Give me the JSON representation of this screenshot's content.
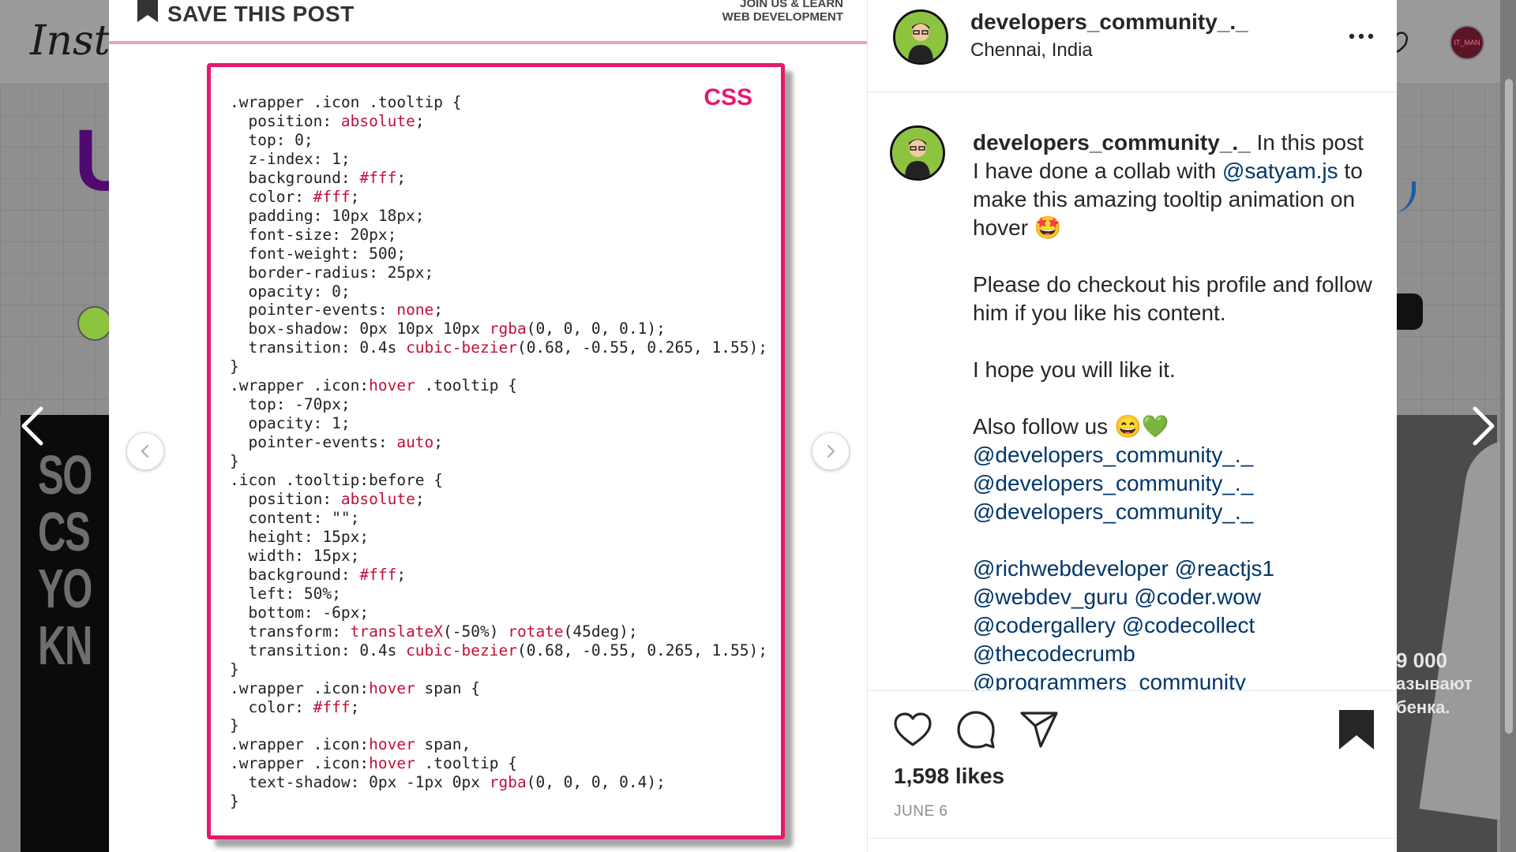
{
  "app": {
    "logo_text": "Insta",
    "current_user_avatar_text": "IT_MAN"
  },
  "background": {
    "big_letter": "U",
    "left_reel_text": "SO\nCS\nYO\nKN",
    "right_reel_text": [
      "9 000",
      "азывают",
      "бенка."
    ]
  },
  "media": {
    "save_label": "SAVE THIS POST",
    "join_line1": "JOIN US & LEARN",
    "join_line2": "WEB DEVELOPMENT",
    "code_language_badge": "CSS",
    "code_lines": [
      [
        {
          "t": ".wrapper .icon .tooltip {"
        }
      ],
      [
        {
          "t": "  position: "
        },
        {
          "t": "absolute",
          "c": "v"
        },
        {
          "t": ";"
        }
      ],
      [
        {
          "t": "  top: 0;"
        }
      ],
      [
        {
          "t": "  z-index: 1;"
        }
      ],
      [
        {
          "t": "  background: "
        },
        {
          "t": "#fff",
          "c": "v"
        },
        {
          "t": ";"
        }
      ],
      [
        {
          "t": "  color: "
        },
        {
          "t": "#fff",
          "c": "v"
        },
        {
          "t": ";"
        }
      ],
      [
        {
          "t": "  padding: 10px 18px;"
        }
      ],
      [
        {
          "t": "  font-size: 20px;"
        }
      ],
      [
        {
          "t": "  font-weight: 500;"
        }
      ],
      [
        {
          "t": "  border-radius: 25px;"
        }
      ],
      [
        {
          "t": "  opacity: 0;"
        }
      ],
      [
        {
          "t": "  pointer-events: "
        },
        {
          "t": "none",
          "c": "v"
        },
        {
          "t": ";"
        }
      ],
      [
        {
          "t": "  box-shadow: 0px 10px 10px "
        },
        {
          "t": "rgba",
          "c": "v"
        },
        {
          "t": "(0, 0, 0, 0.1);"
        }
      ],
      [
        {
          "t": "  transition: 0.4s "
        },
        {
          "t": "cubic-bezier",
          "c": "v"
        },
        {
          "t": "(0.68, -0.55, 0.265, 1.55);"
        }
      ],
      [
        {
          "t": "}"
        }
      ],
      [
        {
          "t": ".wrapper .icon:"
        },
        {
          "t": "hover",
          "c": "v"
        },
        {
          "t": " .tooltip {"
        }
      ],
      [
        {
          "t": "  top: -70px;"
        }
      ],
      [
        {
          "t": "  opacity: 1;"
        }
      ],
      [
        {
          "t": "  pointer-events: "
        },
        {
          "t": "auto",
          "c": "v"
        },
        {
          "t": ";"
        }
      ],
      [
        {
          "t": "}"
        }
      ],
      [
        {
          "t": ".icon .tooltip:before {"
        }
      ],
      [
        {
          "t": "  position: "
        },
        {
          "t": "absolute",
          "c": "v"
        },
        {
          "t": ";"
        }
      ],
      [
        {
          "t": "  content: \"\";"
        }
      ],
      [
        {
          "t": "  height: 15px;"
        }
      ],
      [
        {
          "t": "  width: 15px;"
        }
      ],
      [
        {
          "t": "  background: "
        },
        {
          "t": "#fff",
          "c": "v"
        },
        {
          "t": ";"
        }
      ],
      [
        {
          "t": "  left: 50%;"
        }
      ],
      [
        {
          "t": "  bottom: -6px;"
        }
      ],
      [
        {
          "t": "  transform: "
        },
        {
          "t": "translateX",
          "c": "v"
        },
        {
          "t": "(-50%) "
        },
        {
          "t": "rotate",
          "c": "v"
        },
        {
          "t": "(45deg);"
        }
      ],
      [
        {
          "t": "  transition: 0.4s "
        },
        {
          "t": "cubic-bezier",
          "c": "v"
        },
        {
          "t": "(0.68, -0.55, 0.265, 1.55);"
        }
      ],
      [
        {
          "t": "}"
        }
      ],
      [
        {
          "t": ".wrapper .icon:"
        },
        {
          "t": "hover",
          "c": "v"
        },
        {
          "t": " span {"
        }
      ],
      [
        {
          "t": "  color: "
        },
        {
          "t": "#fff",
          "c": "v"
        },
        {
          "t": ";"
        }
      ],
      [
        {
          "t": "}"
        }
      ],
      [
        {
          "t": ".wrapper .icon:"
        },
        {
          "t": "hover",
          "c": "v"
        },
        {
          "t": " span,"
        }
      ],
      [
        {
          "t": ".wrapper .icon:"
        },
        {
          "t": "hover",
          "c": "v"
        },
        {
          "t": " .tooltip {"
        }
      ],
      [
        {
          "t": "  text-shadow: 0px -1px 0px "
        },
        {
          "t": "rgba",
          "c": "v"
        },
        {
          "t": "(0, 0, 0, 0.4);"
        }
      ],
      [
        {
          "t": "}"
        }
      ]
    ]
  },
  "post": {
    "username": "developers_community_._",
    "location": "Chennai, India",
    "caption": {
      "intro_before": " In this post I have done a collab with ",
      "intro_mention": "@satyam.js",
      "intro_after": " to make this amazing tooltip animation on hover 🤩",
      "para2": "Please do checkout his profile and follow him if you like his content.",
      "para3": "I hope you will like it.",
      "para4": "Also follow us 😄💚",
      "follow_mentions": [
        "@developers_community_._",
        "@developers_community_._",
        "@developers_community_._"
      ],
      "tag_lines": [
        "@richwebdeveloper @reactjs1",
        "@webdev_guru @coder.wow",
        "@codergallery @codecollect",
        "@thecodecrumb",
        "@programmers_community"
      ]
    },
    "likes": "1,598 likes",
    "date": "JUNE 6"
  },
  "colors": {
    "accent_pink": "#e4196e",
    "code_value": "#c0113b",
    "mention_link": "#00376b",
    "avatar_green": "#8cc33f"
  },
  "icons": {
    "save": "bookmark-icon",
    "more": "more-options-icon",
    "like": "heart-icon",
    "comment": "comment-icon",
    "share": "send-icon",
    "bookmark": "bookmark-filled-icon",
    "prev": "chevron-left-icon",
    "next": "chevron-right-icon"
  }
}
